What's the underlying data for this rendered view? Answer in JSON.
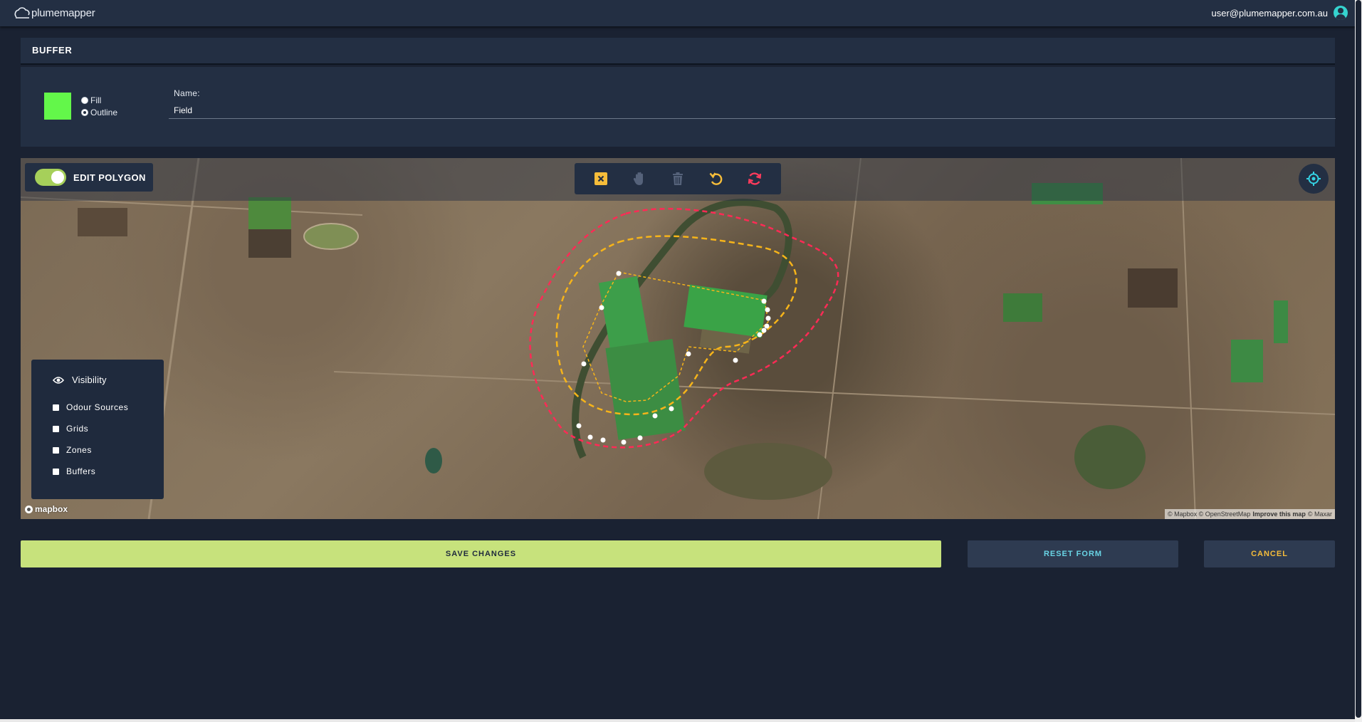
{
  "app": {
    "logo_text": "plumemapper",
    "user_email": "user@plumemapper.com.au"
  },
  "section": {
    "title": "BUFFER"
  },
  "form": {
    "swatch_color": "#63f74a",
    "fill_label": "Fill",
    "outline_label": "Outline",
    "selected_style": "Outline",
    "name_label": "Name:",
    "name_value": "Field"
  },
  "map": {
    "edit_toggle_label": "EDIT POLYGON",
    "edit_toggle_on": true,
    "toolbar": [
      {
        "name": "close-icon",
        "color": "#f6bd3a"
      },
      {
        "name": "hand-icon",
        "color": "#55627a"
      },
      {
        "name": "trash-icon",
        "color": "#55627a"
      },
      {
        "name": "undo-icon",
        "color": "#f6bd3a"
      },
      {
        "name": "refresh-icon",
        "color": "#ff3b5c"
      }
    ],
    "locate_icon": "crosshair-icon",
    "visibility": {
      "title": "Visibility",
      "items": [
        "Odour Sources",
        "Grids",
        "Zones",
        "Buffers"
      ]
    },
    "brand": "mapbox",
    "attribution": {
      "text": "© Mapbox © OpenStreetMap",
      "improve": "Improve this map",
      "maxar": "© Maxar"
    },
    "colors": {
      "outer_buffer": "#ff2a55",
      "inner_buffer": "#f6b41a"
    }
  },
  "actions": {
    "save_label": "SAVE CHANGES",
    "reset_label": "RESET FORM",
    "cancel_label": "CANCEL"
  }
}
